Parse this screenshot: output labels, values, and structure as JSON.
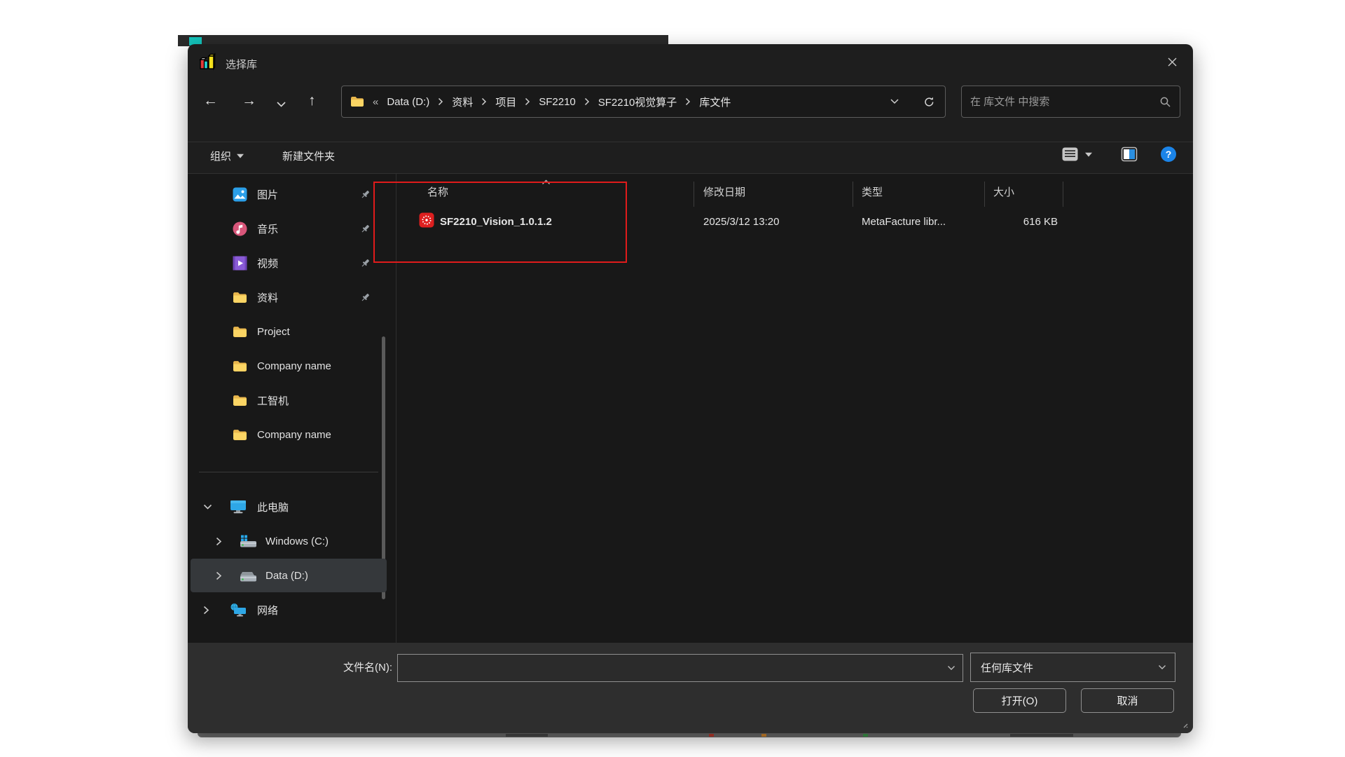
{
  "window": {
    "title": "选择库"
  },
  "nav": {
    "overflow": "«",
    "crumbs": [
      "Data (D:)",
      "资料",
      "项目",
      "SF2210",
      "SF2210视觉算子",
      "库文件"
    ],
    "search_placeholder": "在 库文件 中搜索"
  },
  "toolbar": {
    "organize": "组织",
    "new_folder": "新建文件夹"
  },
  "sidebar": {
    "quick": [
      {
        "label": "图片",
        "pinned": true
      },
      {
        "label": "音乐",
        "pinned": true
      },
      {
        "label": "视频",
        "pinned": true
      },
      {
        "label": "资料",
        "pinned": true
      },
      {
        "label": "Project",
        "pinned": false
      },
      {
        "label": "Company name",
        "pinned": false
      },
      {
        "label": "工智机",
        "pinned": false
      },
      {
        "label": "Company name",
        "pinned": false
      }
    ],
    "tree": [
      {
        "label": "此电脑",
        "selected": false
      },
      {
        "label": "Windows (C:)",
        "selected": false
      },
      {
        "label": "Data (D:)",
        "selected": true
      },
      {
        "label": "网络",
        "selected": false
      }
    ]
  },
  "list": {
    "sort_column": "名称",
    "columns": [
      "名称",
      "修改日期",
      "类型",
      "大小"
    ],
    "rows": [
      {
        "name": "SF2210_Vision_1.0.1.2",
        "date": "2025/3/12 13:20",
        "type": "MetaFacture libr...",
        "size": "616 KB"
      }
    ]
  },
  "footer": {
    "filename_label": "文件名(N):",
    "filename_value": "",
    "filetype_value": "任何库文件",
    "open_label": "打开(O)",
    "cancel_label": "取消"
  },
  "annotations": {
    "highlight_box_color": "#e01b1b"
  },
  "colors": {
    "dialog_bg": "#1e1e1e",
    "content_bg": "#181818",
    "footer_bg": "#2e2e2e",
    "selection_bg": "#35383b",
    "accent_blue": "#1b84e8",
    "folder_yellow": "#f8c84a",
    "file_icon_red": "#dd1f1f"
  }
}
